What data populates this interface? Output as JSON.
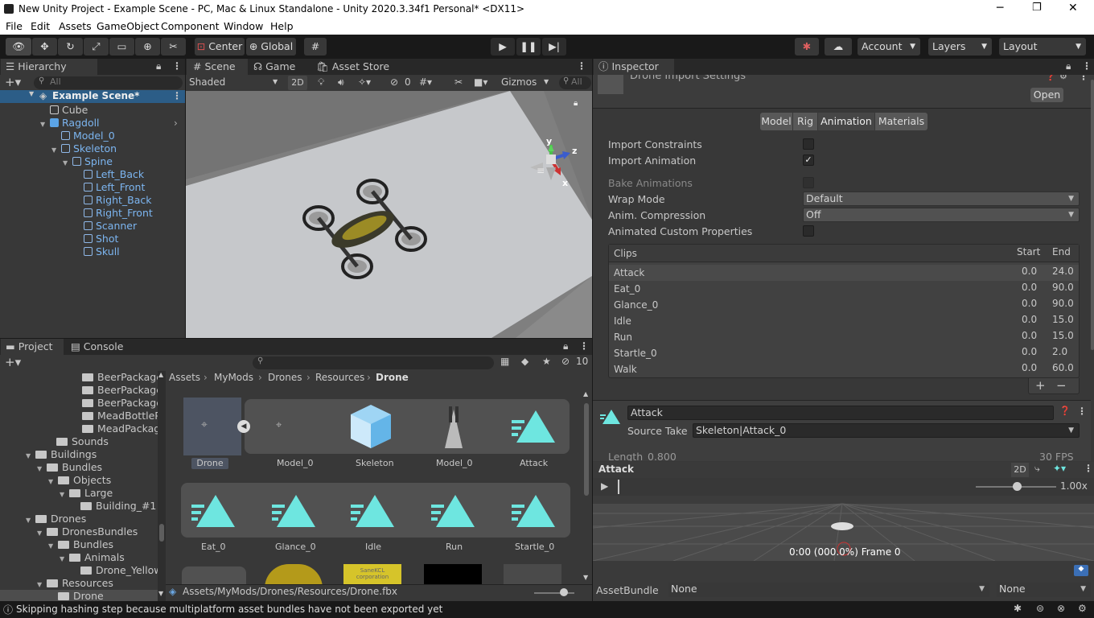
{
  "window": {
    "title": "New Unity Project - Example Scene - PC, Mac & Linux Standalone - Unity 2020.3.34f1 Personal* <DX11>",
    "minimize": "─",
    "maximize": "❐",
    "close": "✕"
  },
  "menu": [
    "File",
    "Edit",
    "Assets",
    "GameObject",
    "Component",
    "Window",
    "Help"
  ],
  "toolbar": {
    "pivot": "Center",
    "space": "Global",
    "account": "Account",
    "layers": "Layers",
    "layout": "Layout"
  },
  "hierarchy": {
    "tab": "Hierarchy",
    "search_placeholder": "All",
    "scene": "Example Scene*",
    "items": [
      "Cube",
      "Ragdoll",
      "Model_0",
      "Skeleton",
      "Spine",
      "Left_Back",
      "Left_Front",
      "Right_Back",
      "Right_Front",
      "Scanner",
      "Shot",
      "Skull"
    ]
  },
  "scene": {
    "tabs": [
      "Scene",
      "Game",
      "Asset Store"
    ],
    "shading": "Shaded",
    "mode2d": "2D",
    "hidden_count": "0",
    "gizmos": "Gizmos",
    "search_placeholder": "All",
    "axes": {
      "y": "y",
      "z": "z",
      "x": "x"
    }
  },
  "project": {
    "tabs": [
      "Project",
      "Console"
    ],
    "hidden_count": "10",
    "tree": [
      "BeerPackage",
      "BeerPackage",
      "BeerPackage",
      "MeadBottleP",
      "MeadPackag",
      "Sounds",
      "Buildings",
      "Bundles",
      "Objects",
      "Large",
      "Building_#1",
      "Drones",
      "DronesBundles",
      "Bundles",
      "Animals",
      "Drone_Yellow",
      "Resources",
      "Drone"
    ],
    "breadcrumb": [
      "Assets",
      "MyMods",
      "Drones",
      "Resources",
      "Drone"
    ],
    "assets_row1": [
      "Drone",
      "Model_0",
      "Skeleton",
      "Model_0",
      "Attack"
    ],
    "assets_row2": [
      "Eat_0",
      "Glance_0",
      "Idle",
      "Run",
      "Startle_0"
    ],
    "row3_label": "SaneKCL corporation",
    "path": "Assets/MyMods/Drones/Resources/Drone.fbx"
  },
  "inspector": {
    "tab": "Inspector",
    "header_title": "Drone Import Settings",
    "open_button": "Open",
    "import_tabs": [
      "Model",
      "Rig",
      "Animation",
      "Materials"
    ],
    "active_tab": "Animation",
    "props": {
      "import_constraints": "Import Constraints",
      "import_animation": "Import Animation",
      "bake_animations": "Bake Animations",
      "wrap_mode": "Wrap Mode",
      "wrap_mode_value": "Default",
      "anim_compression": "Anim. Compression",
      "anim_compression_value": "Off",
      "animated_custom": "Animated Custom Properties",
      "import_animation_checked": "✓"
    },
    "clips": {
      "header": "Clips",
      "start": "Start",
      "end": "End",
      "rows": [
        {
          "name": "Attack",
          "start": "0.0",
          "end": "24.0"
        },
        {
          "name": "Eat_0",
          "start": "0.0",
          "end": "90.0"
        },
        {
          "name": "Glance_0",
          "start": "0.0",
          "end": "90.0"
        },
        {
          "name": "Idle",
          "start": "0.0",
          "end": "15.0"
        },
        {
          "name": "Run",
          "start": "0.0",
          "end": "15.0"
        },
        {
          "name": "Startle_0",
          "start": "0.0",
          "end": "2.0"
        },
        {
          "name": "Walk",
          "start": "0.0",
          "end": "60.0"
        }
      ],
      "add": "+",
      "remove": "−"
    },
    "clip_name": "Attack",
    "source_take_label": "Source Take",
    "source_take": "Skeleton|Attack_0",
    "length_label": "Length",
    "length_value": "0.800",
    "fps": "30 FPS",
    "preview": {
      "title": "Attack",
      "mode2d": "2D",
      "speed": "1.00x",
      "status": "0:00 (000.0%) Frame 0"
    },
    "assetbundle_label": "AssetBundle",
    "assetbundle_value": "None",
    "assetbundle_variant": "None"
  },
  "status": {
    "message": "Skipping hashing step because multiplatform asset bundles have not been exported yet"
  }
}
